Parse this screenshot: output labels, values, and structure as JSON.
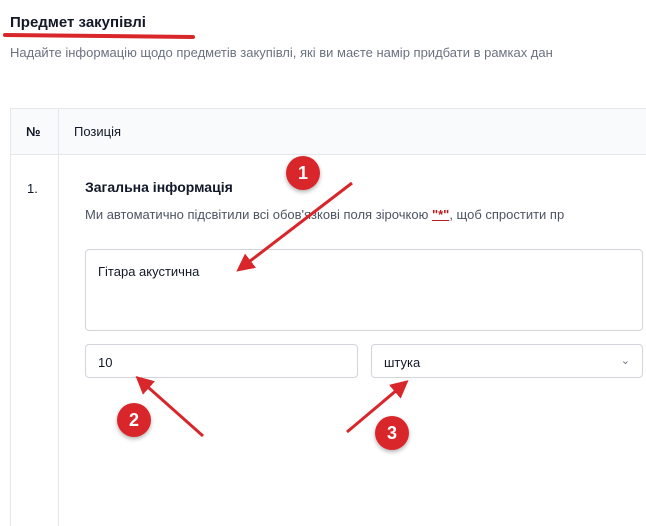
{
  "section": {
    "title": "Предмет закупівлі",
    "description": "Надайте інформацію щодо предметів закупівлі, які ви маєте намір придбати в рамках дан"
  },
  "table": {
    "col_number": "№",
    "col_position": "Позиція"
  },
  "item": {
    "number": "1.",
    "title": "Загальна інформація",
    "desc_before": "Ми автоматично підсвітили всі обов'язкові поля зірочкою ",
    "desc_star": "\"*\"",
    "desc_after": ", щоб спростити пр",
    "name_value": "Гітара акустична",
    "quantity_value": "10",
    "unit_value": "штука"
  },
  "annotations": {
    "marker1": "1",
    "marker2": "2",
    "marker3": "3",
    "color": "#d8262b"
  },
  "icons": {
    "unit_chevron": "chevron-down-icon"
  }
}
